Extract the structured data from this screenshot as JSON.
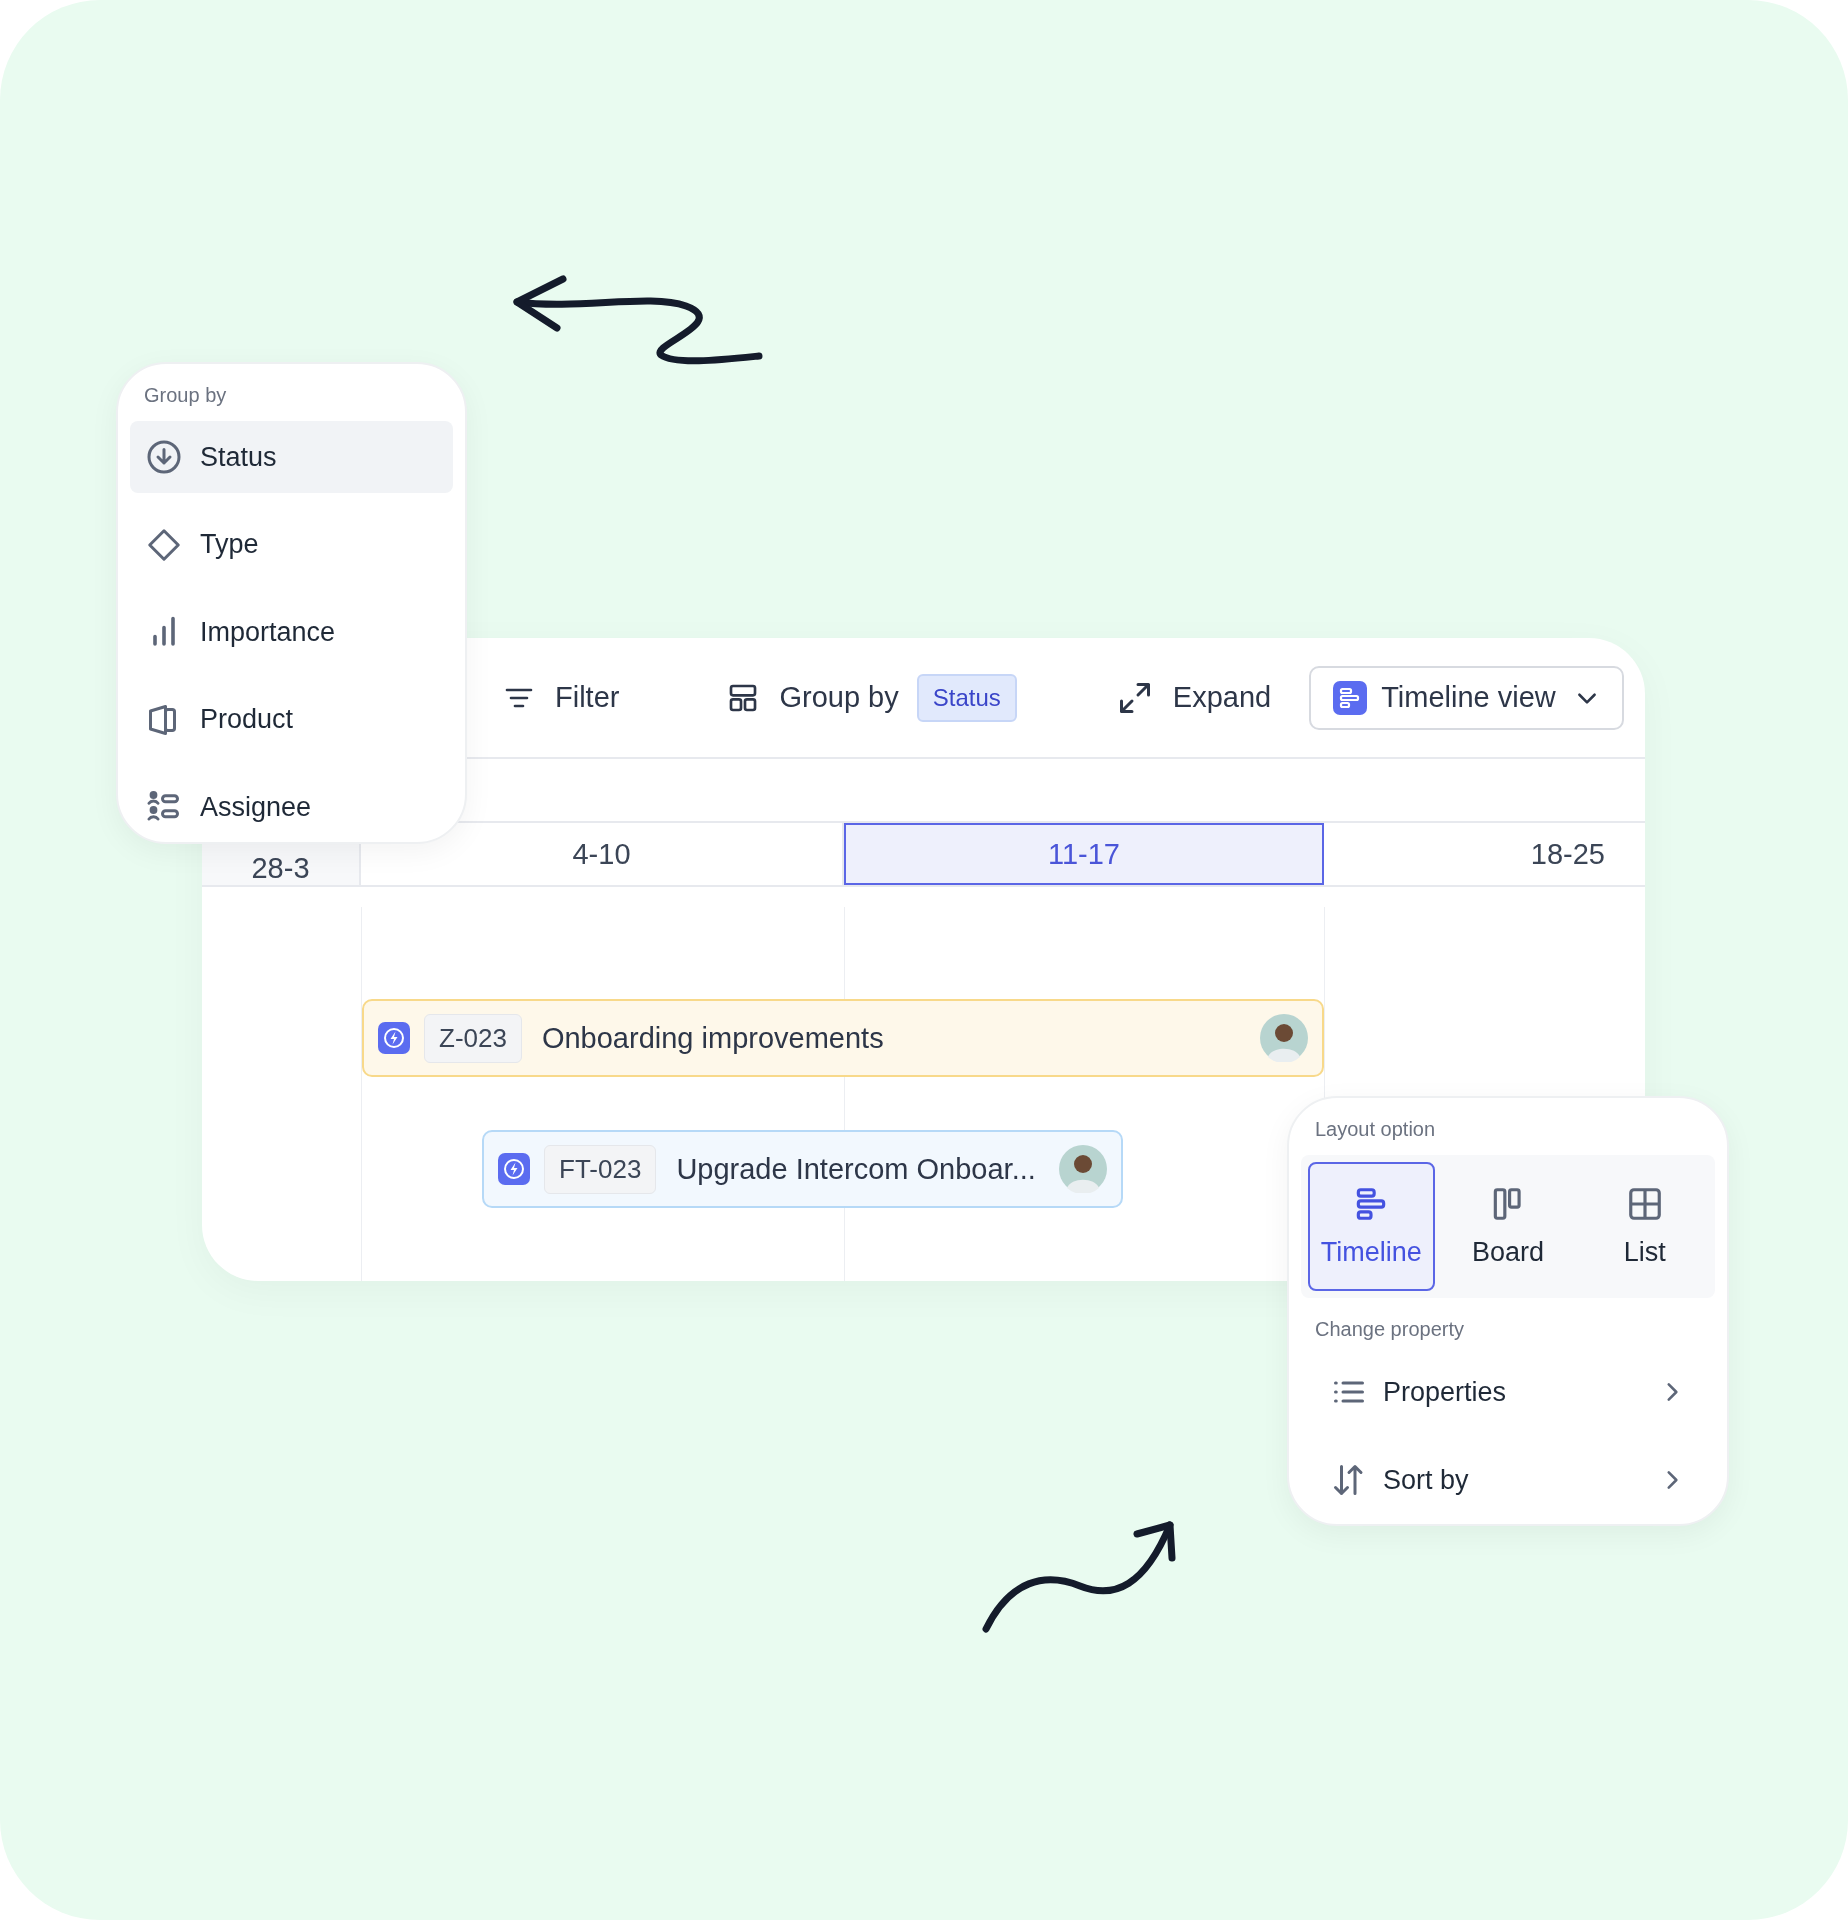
{
  "group_by_menu": {
    "title": "Group by",
    "items": [
      {
        "label": "Status",
        "selected": true
      },
      {
        "label": "Type",
        "selected": false
      },
      {
        "label": "Importance",
        "selected": false
      },
      {
        "label": "Product",
        "selected": false
      },
      {
        "label": "Assignee",
        "selected": false
      }
    ]
  },
  "toolbar": {
    "filter": "Filter",
    "group_by": {
      "label": "Group by",
      "value": "Status"
    },
    "expand": "Expand",
    "view_select": "Timeline view"
  },
  "timeline": {
    "columns": [
      {
        "label": "28-3",
        "selected": false
      },
      {
        "label": "4-10",
        "selected": false
      },
      {
        "label": "11-17",
        "selected": true
      },
      {
        "label": "18-25",
        "selected": false
      }
    ],
    "tasks": [
      {
        "id": "Z-023",
        "title": "Onboarding improvements",
        "color": "#f8d98a"
      },
      {
        "id": "FT-023",
        "title": "Upgrade Intercom Onboar...",
        "color": "#b6d9f7"
      }
    ]
  },
  "layout_menu": {
    "title": "Layout option",
    "options": [
      {
        "label": "Timeline",
        "selected": true
      },
      {
        "label": "Board",
        "selected": false
      },
      {
        "label": "List",
        "selected": false
      }
    ],
    "section": "Change property",
    "items": [
      "Properties",
      "Sort by"
    ]
  }
}
